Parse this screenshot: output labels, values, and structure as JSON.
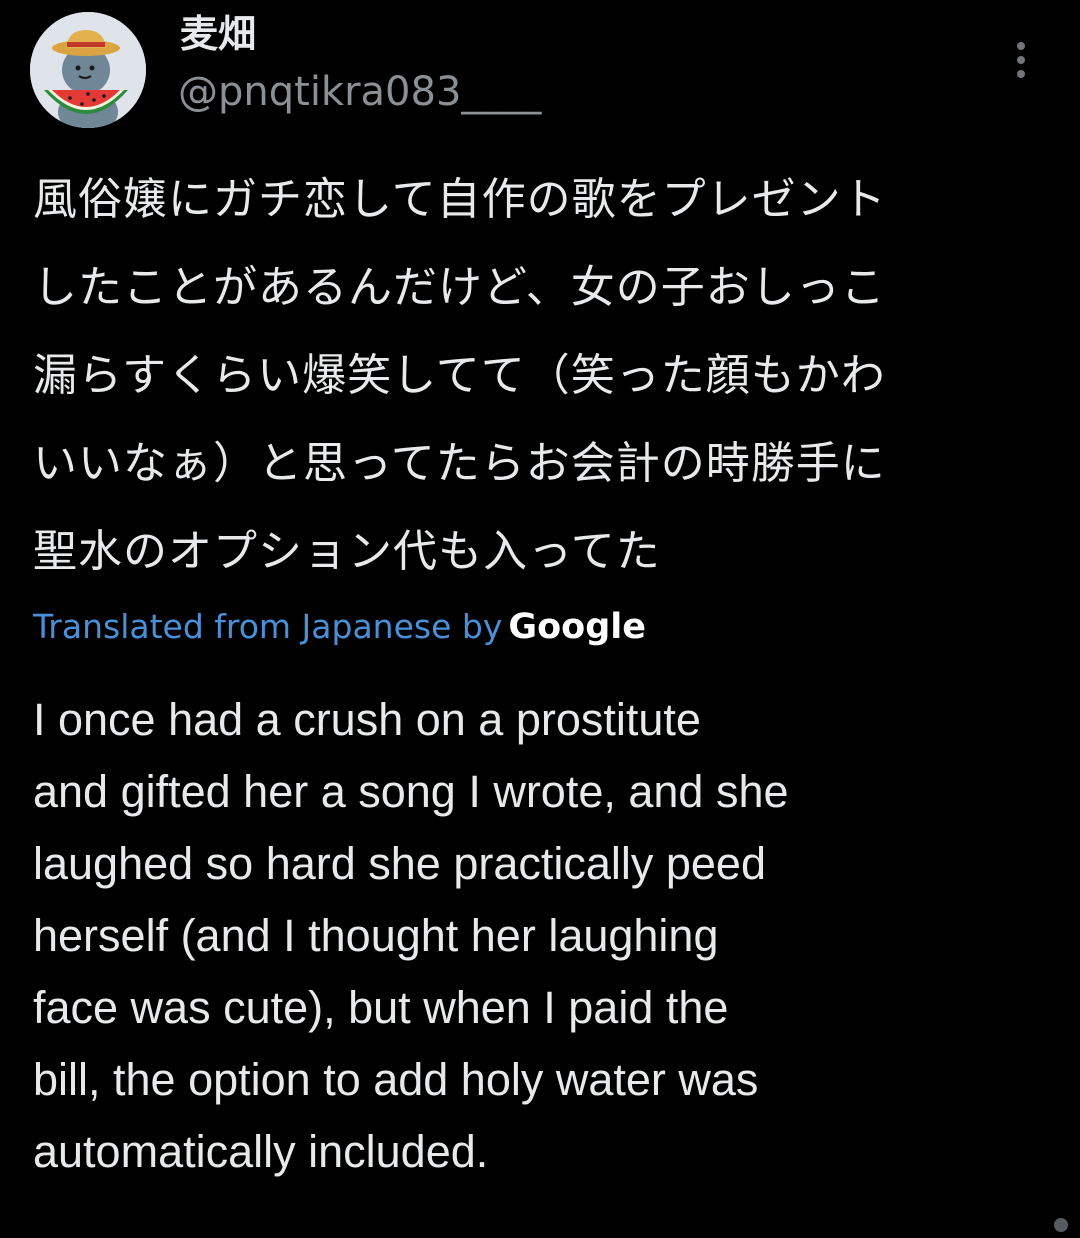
{
  "author": {
    "display_name": "麦畑",
    "handle": "@pnqtikra083____",
    "avatar_icon": "avatar-straw-hat-watermelon-icon"
  },
  "menu": {
    "icon": "more-vertical-icon"
  },
  "tweet": {
    "original_text": "風俗嬢にガチ恋して自作の歌をプレゼント\nしたことがあるんだけど、女の子おしっこ\n漏らすくらい爆笑してて（笑った顔もかわ\nいいなぁ）と思ってたらお会計の時勝手に\n聖水のオプション代も入ってた",
    "translation_label": "Translated from Japanese by",
    "translation_provider": "Google",
    "translated_text": "I once had a crush on a prostitute\nand gifted her a song I wrote, and she\nlaughed so hard she practically peed\nherself (and I thought her laughing\nface was cute), but when I paid the\nbill, the option to add holy water was\nautomatically included."
  },
  "colors": {
    "background": "#000000",
    "text": "#e7e9ea",
    "secondary_text": "#8b9095",
    "link": "#4a90d9"
  }
}
